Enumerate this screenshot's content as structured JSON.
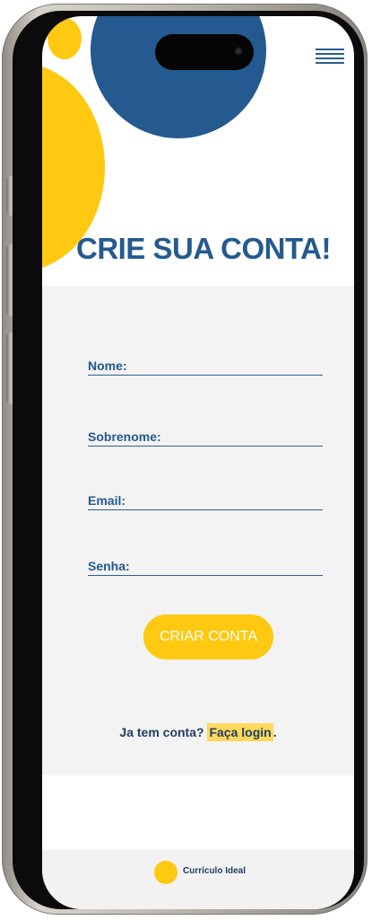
{
  "colors": {
    "primary_blue": "#245a8f",
    "accent_yellow": "#ffc911",
    "form_background": "#f3f3f3"
  },
  "header": {
    "menu_icon": "hamburger-menu-icon"
  },
  "signup": {
    "title": "CRIE SUA CONTA!",
    "fields": [
      {
        "label": "Nome:",
        "value": ""
      },
      {
        "label": "Sobrenome:",
        "value": ""
      },
      {
        "label": "Email:",
        "value": ""
      },
      {
        "label": "Senha:",
        "value": ""
      }
    ],
    "submit_label": "CRIAR CONTA",
    "login_prompt": "Ja tem conta?",
    "login_link": "Faça login",
    "login_suffix": "."
  },
  "footer": {
    "brand": "Currículo Ideal"
  }
}
